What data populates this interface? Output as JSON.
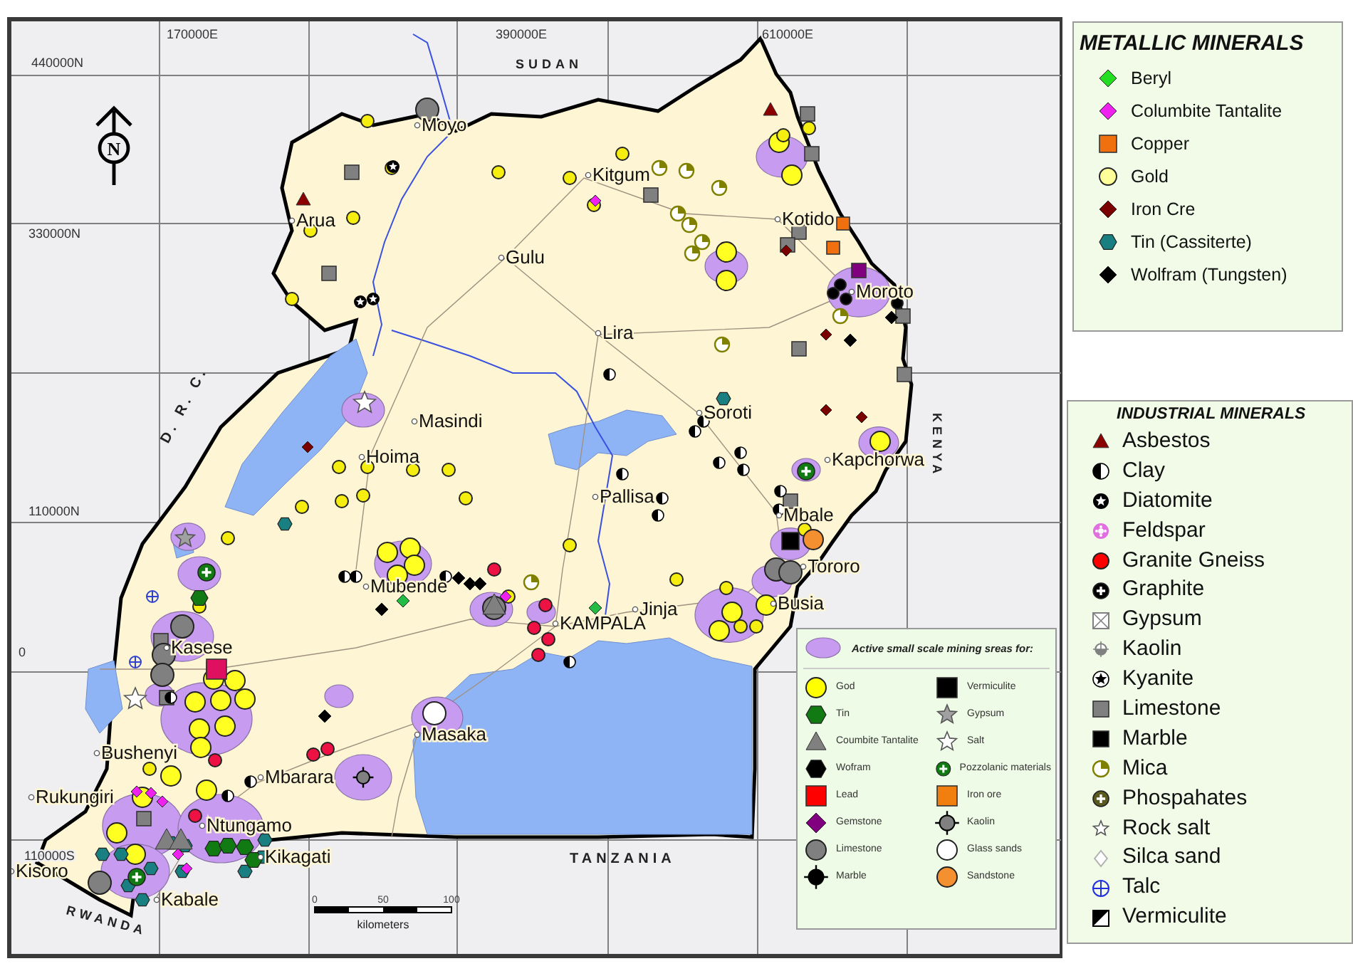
{
  "map": {
    "grid_labels": [
      "170000E",
      "390000E",
      "610000E",
      "440000N",
      "330000N",
      "110000N",
      "0",
      "110000S"
    ],
    "neighbors": [
      "SUDAN",
      "KENYA",
      "TANZANIA",
      "D. R. C.",
      "RWANDA"
    ],
    "north_label": "N",
    "towns": [
      {
        "name": "Moyo"
      },
      {
        "name": "Arua"
      },
      {
        "name": "Gulu"
      },
      {
        "name": "Kitgum"
      },
      {
        "name": "Kotido"
      },
      {
        "name": "Moroto"
      },
      {
        "name": "Lira"
      },
      {
        "name": "Masindi"
      },
      {
        "name": "Hoima"
      },
      {
        "name": "Soroti"
      },
      {
        "name": "Kapchorwa"
      },
      {
        "name": "Pallisa"
      },
      {
        "name": "Mbale"
      },
      {
        "name": "Tororo"
      },
      {
        "name": "Mubende"
      },
      {
        "name": "KAMPALA"
      },
      {
        "name": "Jinja"
      },
      {
        "name": "Busia"
      },
      {
        "name": "Kasese"
      },
      {
        "name": "Masaka"
      },
      {
        "name": "Bushenyi"
      },
      {
        "name": "Mbarara"
      },
      {
        "name": "Rukungiri"
      },
      {
        "name": "Ntungamo"
      },
      {
        "name": "Kikagati"
      },
      {
        "name": "Kisoro"
      },
      {
        "name": "Kabale"
      }
    ],
    "scale": {
      "ticks": [
        "0",
        "50",
        "100"
      ],
      "unit": "kilometers"
    }
  },
  "small_scale_legend": {
    "title": "Active small scale mining sreas for:",
    "items": [
      {
        "label": "God",
        "kind": "circle",
        "color": "#ffff00"
      },
      {
        "label": "Tin",
        "kind": "hexagon",
        "color": "#127a12"
      },
      {
        "label": "Coumbite Tantalite",
        "kind": "triangle",
        "color": "#808080"
      },
      {
        "label": "Wofram",
        "kind": "hexagon",
        "color": "#000000"
      },
      {
        "label": "Lead",
        "kind": "square",
        "color": "#ff0000"
      },
      {
        "label": "Gemstone",
        "kind": "diamond",
        "color": "#800080"
      },
      {
        "label": "Limestone",
        "kind": "circle",
        "color": "#808080"
      },
      {
        "label": "Marble",
        "kind": "marble-cross",
        "color": "#000000"
      },
      {
        "label": "Vermiculite",
        "kind": "square",
        "color": "#000000"
      },
      {
        "label": "Gypsum",
        "kind": "star",
        "color": "#a0a0a0"
      },
      {
        "label": "Salt",
        "kind": "star",
        "color": "#ffffff"
      },
      {
        "label": "Pozzolanic materials",
        "kind": "plus-circle",
        "color": "#127a12"
      },
      {
        "label": "Iron ore",
        "kind": "square",
        "color": "#f07f10"
      },
      {
        "label": "Kaolin",
        "kind": "marble-cross",
        "color": "#808080"
      },
      {
        "label": "Glass sands",
        "kind": "circle",
        "color": "#ffffff"
      },
      {
        "label": "Sandstone",
        "kind": "circle",
        "color": "#f59030"
      }
    ]
  },
  "metallic_minerals": {
    "title": "METALLIC MINERALS",
    "items": [
      {
        "label": "Beryl",
        "kind": "diamond",
        "color": "#22dd22"
      },
      {
        "label": "Columbite Tantalite",
        "kind": "diamond",
        "color": "#ee22ee"
      },
      {
        "label": "Copper",
        "kind": "square",
        "color": "#f07010"
      },
      {
        "label": "Gold",
        "kind": "circle",
        "color": "#ffff99"
      },
      {
        "label": "Iron Cre",
        "kind": "diamond",
        "color": "#7a0000"
      },
      {
        "label": "Tin (Cassiterte)",
        "kind": "hexagon",
        "color": "#1a7f80"
      },
      {
        "label": "Wolfram (Tungsten)",
        "kind": "diamond",
        "color": "#000000"
      }
    ]
  },
  "industrial_minerals": {
    "title": "INDUSTRIAL MINERALS",
    "items": [
      {
        "label": "Asbestos",
        "kind": "triangle",
        "color": "#8b0000"
      },
      {
        "label": "Clay",
        "kind": "half",
        "color": "#000000"
      },
      {
        "label": "Diatomite",
        "kind": "ring-star",
        "color": "#000000"
      },
      {
        "label": "Feldspar",
        "kind": "flower",
        "color": "#e070e0"
      },
      {
        "label": "Granite Gneiss",
        "kind": "circle",
        "color": "#ff0000"
      },
      {
        "label": "Graphite",
        "kind": "plus-circle",
        "color": "#000000"
      },
      {
        "label": "Gypsum",
        "kind": "box-x",
        "color": "#808080"
      },
      {
        "label": "Kaolin",
        "kind": "kaolin",
        "color": "#808080"
      },
      {
        "label": "Kyanite",
        "kind": "star-circle",
        "color": "#000000"
      },
      {
        "label": "Limestone",
        "kind": "square",
        "color": "#808080"
      },
      {
        "label": "Marble",
        "kind": "square",
        "color": "#000000"
      },
      {
        "label": "Mica",
        "kind": "pie",
        "color": "#808000"
      },
      {
        "label": "Phospahates",
        "kind": "plus-circle",
        "color": "#5a5a20"
      },
      {
        "label": "Rock salt",
        "kind": "star",
        "color": "#ffffff"
      },
      {
        "label": "Silca sand",
        "kind": "diamond-outline",
        "color": "#b0b0b0"
      },
      {
        "label": "Talc",
        "kind": "cross-circle",
        "color": "#2030e0"
      },
      {
        "label": "Vermiculite",
        "kind": "split-square",
        "color": "#000000"
      }
    ]
  }
}
